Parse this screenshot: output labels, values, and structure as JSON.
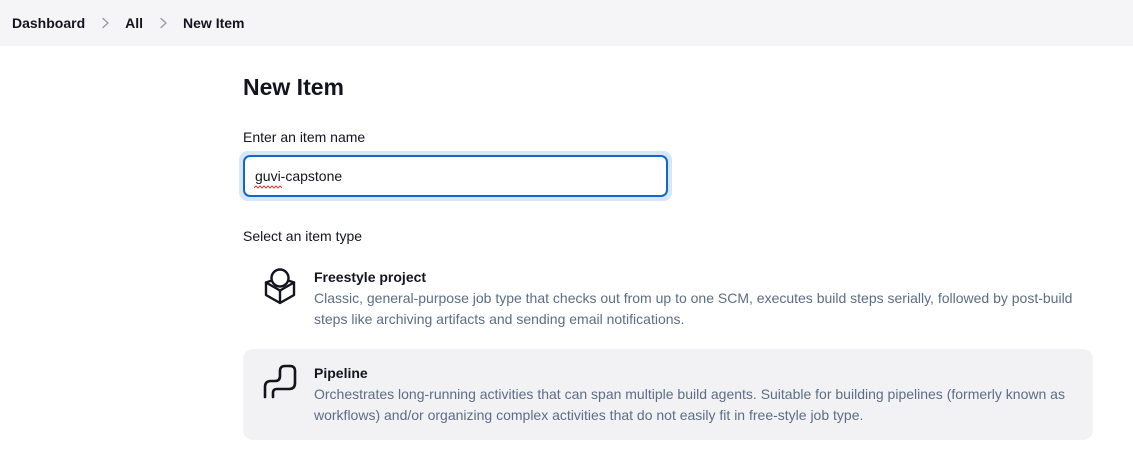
{
  "breadcrumb": {
    "items": [
      "Dashboard",
      "All"
    ],
    "current": "New Item"
  },
  "page": {
    "title": "New Item"
  },
  "name_field": {
    "label": "Enter an item name",
    "value": "guvi-capstone"
  },
  "item_types": {
    "label": "Select an item type",
    "options": [
      {
        "name": "Freestyle project",
        "description": "Classic, general-purpose job type that checks out from up to one SCM, executes build steps serially, followed by post-build steps like archiving artifacts and sending email notifications.",
        "icon": "freestyle-project-icon"
      },
      {
        "name": "Pipeline",
        "description": "Orchestrates long-running activities that can span multiple build agents. Suitable for building pipelines (formerly known as workflows) and/or organizing complex activities that do not easily fit in free-style job type.",
        "icon": "pipeline-icon"
      }
    ]
  },
  "colors": {
    "topbar_bg": "#f5f5f7",
    "accent": "#1467c9",
    "hover_bg": "#f2f2f5",
    "desc_text": "#5d6d85"
  }
}
